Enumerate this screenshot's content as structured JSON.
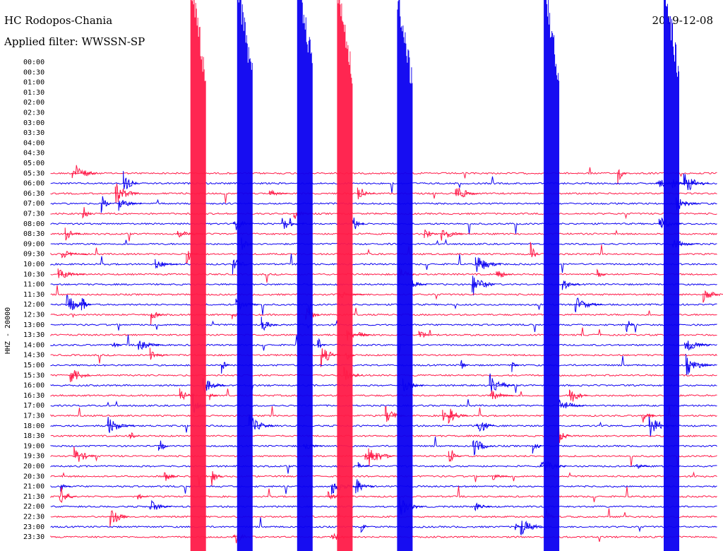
{
  "header": {
    "station": "HC Rodopos-Chania",
    "filter": "Applied filter: WWSSN-SP",
    "date": "2019-12-08"
  },
  "chart_data": {
    "type": "helicorder",
    "ylabel": "HHZ - 20000",
    "time_labels": [
      "00:00",
      "00:30",
      "01:00",
      "01:30",
      "02:00",
      "02:30",
      "03:00",
      "03:30",
      "04:00",
      "04:30",
      "05:00",
      "05:30",
      "06:00",
      "06:30",
      "07:00",
      "07:30",
      "08:00",
      "08:30",
      "09:00",
      "09:30",
      "10:00",
      "10:30",
      "11:00",
      "11:30",
      "12:00",
      "12:30",
      "13:00",
      "13:30",
      "14:00",
      "14:30",
      "15:00",
      "15:30",
      "16:00",
      "16:30",
      "17:00",
      "17:30",
      "18:00",
      "18:30",
      "19:00",
      "19:30",
      "20:00",
      "20:30",
      "21:00",
      "21:30",
      "22:00",
      "22:30",
      "23:00",
      "23:30"
    ],
    "trace_start": "05:30",
    "colors": {
      "even_row": "#0b00f0",
      "odd_row": "#ff1a48"
    },
    "large_events": [
      {
        "row": "06:00",
        "pos": 0.21,
        "amp": 1.0,
        "color": "red"
      },
      {
        "row": "06:00",
        "pos": 0.28,
        "amp": 1.0,
        "color": "blue"
      },
      {
        "row": "06:00",
        "pos": 0.43,
        "amp": 1.0,
        "color": "red"
      },
      {
        "row": "05:30",
        "pos": 0.37,
        "amp": 1.0,
        "color": "blue"
      },
      {
        "row": "06:30",
        "pos": 0.52,
        "amp": 1.0,
        "color": "blue"
      },
      {
        "row": "06:00",
        "pos": 0.92,
        "amp": 1.0,
        "color": "blue"
      },
      {
        "row": "06:00",
        "pos": 0.74,
        "amp": 1.0,
        "color": "blue"
      }
    ]
  }
}
